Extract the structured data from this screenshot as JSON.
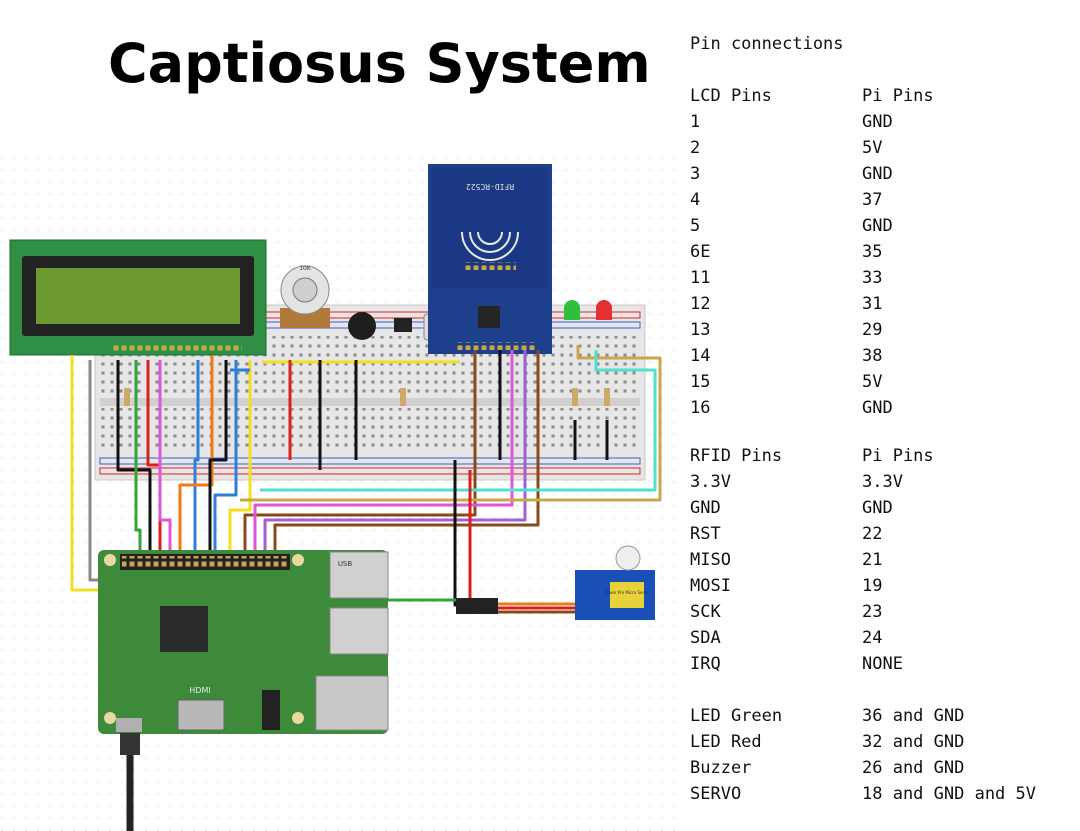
{
  "title": "Captiosus System",
  "pin_panel": {
    "heading": "Pin connections",
    "sections": [
      {
        "col1": "LCD Pins",
        "col2": "Pi Pins",
        "rows": [
          [
            "1",
            "GND"
          ],
          [
            "2",
            "5V"
          ],
          [
            "3",
            "GND"
          ],
          [
            "4",
            "37"
          ],
          [
            "5",
            "GND"
          ],
          [
            "6E",
            "35"
          ],
          [
            "11",
            "33"
          ],
          [
            "12",
            "31"
          ],
          [
            "13",
            "29"
          ],
          [
            "14",
            "38"
          ],
          [
            "15",
            "5V"
          ],
          [
            "16",
            "GND"
          ]
        ]
      },
      {
        "col1": "RFID Pins",
        "col2": "Pi Pins",
        "rows": [
          [
            "3.3V",
            "3.3V"
          ],
          [
            "GND",
            "GND"
          ],
          [
            "RST",
            "22"
          ],
          [
            "MISO",
            "21"
          ],
          [
            "MOSI",
            "19"
          ],
          [
            "SCK",
            "23"
          ],
          [
            "SDA",
            "24"
          ],
          [
            "IRQ",
            "NONE"
          ]
        ]
      },
      {
        "rows": [
          [
            "LED Green",
            "36 and GND"
          ],
          [
            "LED Red",
            "32 and GND"
          ],
          [
            "Buzzer",
            "26 and GND"
          ],
          [
            "SERVO",
            "18 and GND and 5V"
          ]
        ]
      }
    ]
  },
  "module_labels": {
    "rfid": "RFID-RC522",
    "pot": "10K",
    "hdmi": "HDMI",
    "usb": "USB",
    "servo": "Tower Pro Micro Servo"
  },
  "colors": {
    "lcd_frame": "#2f8f44",
    "lcd_screen": "#6c9a2e",
    "rfid_board": "#1d3f8c",
    "pi_board": "#3c8a3a",
    "servo_body": "#1a4fb8",
    "wire_red": "#d6221c",
    "wire_black": "#111111",
    "wire_green": "#2fa63a",
    "wire_yellow": "#f2e01e",
    "wire_blue": "#2f7fd8",
    "wire_orange": "#ef7a18",
    "wire_magenta": "#e055d8",
    "wire_brown": "#8a4a18",
    "wire_cyan": "#4fe0d0",
    "wire_purple": "#a060d0"
  }
}
